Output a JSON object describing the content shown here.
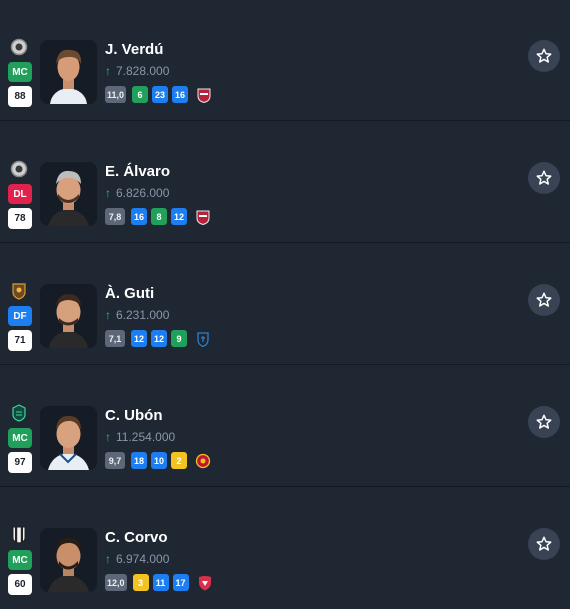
{
  "colors": {
    "background": "#1f2733",
    "pos_MC": "#20a05a",
    "pos_DL": "#e0224c",
    "pos_DF": "#1c7ef0",
    "stat_blue": "#1c7ef0",
    "stat_green": "#20a05a",
    "stat_yellow": "#f2c321",
    "stat_gray": "#5d6778",
    "trend_up": "#2bbf6f"
  },
  "players": [
    {
      "name": "J. Verdú",
      "position": "MC",
      "position_color": "#20a05a",
      "rating": "88",
      "value": "7.828.000",
      "trend_icon": "arrow-up-icon",
      "team_icon": "club-crest-icon",
      "opponent_icon": "opponent-crest-icon",
      "stats": [
        {
          "label": "11,0",
          "color": "#5d6778"
        },
        {
          "label": "6",
          "color": "#20a05a"
        },
        {
          "label": "23",
          "color": "#1c7ef0"
        },
        {
          "label": "16",
          "color": "#1c7ef0"
        }
      ]
    },
    {
      "name": "E. Álvaro",
      "position": "DL",
      "position_color": "#e0224c",
      "rating": "78",
      "value": "6.826.000",
      "trend_icon": "arrow-up-icon",
      "team_icon": "club-crest-icon",
      "opponent_icon": "opponent-crest-icon",
      "stats": [
        {
          "label": "7,8",
          "color": "#5d6778"
        },
        {
          "label": "16",
          "color": "#1c7ef0"
        },
        {
          "label": "8",
          "color": "#20a05a"
        },
        {
          "label": "12",
          "color": "#1c7ef0"
        }
      ]
    },
    {
      "name": "À. Guti",
      "position": "DF",
      "position_color": "#1c7ef0",
      "rating": "71",
      "value": "6.231.000",
      "trend_icon": "arrow-up-icon",
      "team_icon": "club-crest-icon",
      "opponent_icon": "opponent-crest-icon",
      "stats": [
        {
          "label": "7,1",
          "color": "#5d6778"
        },
        {
          "label": "12",
          "color": "#1c7ef0"
        },
        {
          "label": "12",
          "color": "#1c7ef0"
        },
        {
          "label": "9",
          "color": "#20a05a"
        }
      ]
    },
    {
      "name": "C. Ubón",
      "position": "MC",
      "position_color": "#20a05a",
      "rating": "97",
      "value": "11.254.000",
      "trend_icon": "arrow-up-icon",
      "team_icon": "club-crest-icon",
      "opponent_icon": "opponent-crest-icon",
      "stats": [
        {
          "label": "9,7",
          "color": "#5d6778"
        },
        {
          "label": "18",
          "color": "#1c7ef0"
        },
        {
          "label": "10",
          "color": "#1c7ef0"
        },
        {
          "label": "2",
          "color": "#f2c321"
        }
      ]
    },
    {
      "name": "C. Corvo",
      "position": "MC",
      "position_color": "#20a05a",
      "rating": "60",
      "value": "6.974.000",
      "trend_icon": "arrow-up-icon",
      "team_icon": "club-crest-icon",
      "opponent_icon": "opponent-crest-icon",
      "stats": [
        {
          "label": "12,0",
          "color": "#5d6778"
        },
        {
          "label": "3",
          "color": "#f2c321"
        },
        {
          "label": "11",
          "color": "#1c7ef0"
        },
        {
          "label": "17",
          "color": "#1c7ef0"
        }
      ]
    }
  ]
}
